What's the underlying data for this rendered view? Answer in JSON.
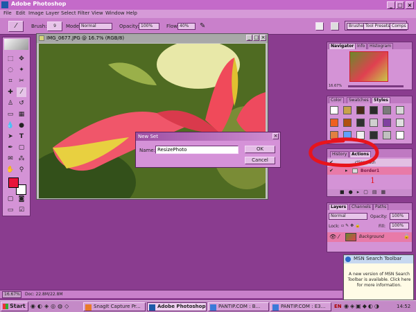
{
  "app": {
    "title": "Adobe Photoshop"
  },
  "menu": [
    "File",
    "Edit",
    "Image",
    "Layer",
    "Select",
    "Filter",
    "View",
    "Window",
    "Help"
  ],
  "options": {
    "brush_label": "Brush:",
    "brush_size": "9",
    "mode_label": "Mode:",
    "mode_value": "Normal",
    "opacity_label": "Opacity:",
    "opacity_value": "100%",
    "flow_label": "Flow:",
    "flow_value": "40%"
  },
  "palette_well": {
    "tabs": [
      "Brushes",
      "Tool Presets",
      "Comps"
    ]
  },
  "document": {
    "title": "IMG_0677.JPG @ 16.7% (RGB/8)"
  },
  "dialog": {
    "title": "New Set",
    "name_label": "Name:",
    "name_value": "ResizePhoto",
    "ok": "OK",
    "cancel": "Cancel"
  },
  "navigator": {
    "tabs": [
      "Navigator",
      "Info",
      "Histogram"
    ],
    "zoom": "16.67%"
  },
  "styles_panel": {
    "tabs": [
      "Color",
      "Swatches",
      "Styles"
    ],
    "swatches": [
      "#ffffff",
      "#c9a24a",
      "#4a2a1a",
      "#2a2a2a",
      "#7a7a7a",
      "#d8d8d8",
      "#f06020",
      "#b05010",
      "#303030",
      "#d0d0d0",
      "#8040a0",
      "#e0e0e0",
      "#e08040",
      "#60a0ff",
      "#f0f0f0",
      "#303030",
      "#c0c0c0",
      "#ffffff"
    ]
  },
  "actions_panel": {
    "tabs": [
      "History",
      "Actions"
    ],
    "row1": "ctions.atn",
    "row2": "Border1",
    "annotation": "1"
  },
  "layers_panel": {
    "tabs": [
      "Layers",
      "Channels",
      "Paths"
    ],
    "mode": "Normal",
    "opacity_label": "Opacity:",
    "opacity": "100%",
    "lock_label": "Lock:",
    "fill_label": "Fill:",
    "fill": "100%",
    "layer_name": "Background"
  },
  "status": {
    "zoom": "16.67%",
    "doc": "Doc: 22.8M/22.8M"
  },
  "taskbar": {
    "start": "Start",
    "tasks": [
      "SnagIt Capture Pr...",
      "Adobe Photoshop",
      "PANTIP.COM : B...",
      "PANTIP.COM : E3..."
    ],
    "lang": "EN",
    "clock": "14:52"
  },
  "msn": {
    "title": "MSN Search Toolbar",
    "body": "A new version of MSN Search Toolbar is available. Click here for more information."
  },
  "colors": {
    "annotation_red": "#e8141c",
    "foreground": "#e8143c",
    "background": "#ffffff"
  }
}
